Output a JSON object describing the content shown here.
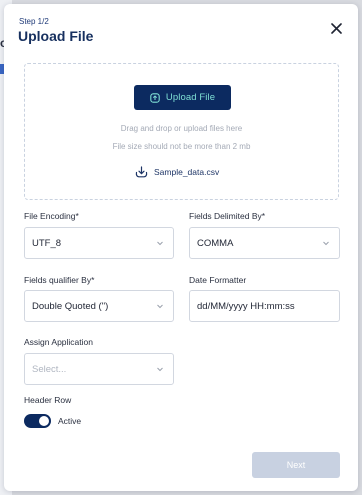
{
  "background": {
    "partial_text": "o"
  },
  "modal": {
    "step": "Step 1/2",
    "title": "Upload File",
    "close_icon": "close-icon"
  },
  "dropzone": {
    "upload_button": "Upload File",
    "upload_icon": "upload-icon",
    "hint_line_1": "Drag and drop or upload files here",
    "hint_line_2": "File size should not be more than 2 mb",
    "sample_link": "Sample_data.csv",
    "sample_icon": "download-icon"
  },
  "fields": {
    "file_encoding": {
      "label": "File Encoding*",
      "value": "UTF_8"
    },
    "fields_delimited_by": {
      "label": "Fields Delimited By*",
      "value": "COMMA"
    },
    "fields_qualifier_by": {
      "label": "Fields qualifier By*",
      "value": "Double Quoted (\")"
    },
    "date_formatter": {
      "label": "Date Formatter",
      "value": "dd/MM/yyyy HH:mm:ss"
    },
    "assign_application": {
      "label": "Assign Application",
      "placeholder": "Select..."
    }
  },
  "header_row": {
    "label": "Header Row",
    "toggle_state": "Active"
  },
  "footer": {
    "next_button": "Next"
  },
  "colors": {
    "primary": "#0c2a60",
    "upload_button_text": "#7fe0d5",
    "next_disabled": "#c8d1e1",
    "border": "#d2d7e0"
  }
}
